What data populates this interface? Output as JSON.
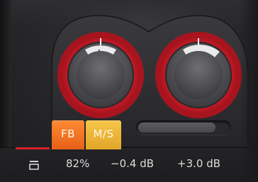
{
  "buttons": {
    "fb_label": "FB",
    "ms_label": "M/S"
  },
  "readouts": {
    "mix": "82%",
    "gain_1": "−0.4 dB",
    "gain_2": "+3.0 dB"
  },
  "knobs": [
    {
      "name": "left-knob",
      "level": 0.45
    },
    {
      "name": "right-knob",
      "level": 0.56
    }
  ],
  "slider": {
    "level": 0.85
  },
  "icons": {
    "menu": "menu-icon"
  },
  "colors": {
    "knob_red": "#d01e2a",
    "fb_orange": "#e8631a",
    "ms_yellow": "#e3a82a",
    "strip_red": "#d8202c",
    "text": "#dcdcdc"
  }
}
